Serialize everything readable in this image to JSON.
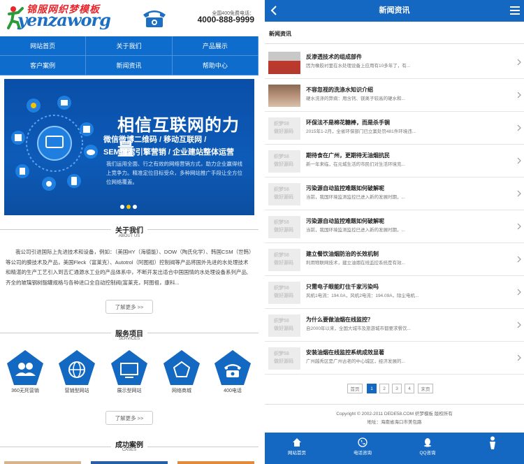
{
  "left": {
    "logo_cn": "锦服网织梦模板",
    "logo_en": "yenzaworg",
    "hotline_label": "全国400免费电话：",
    "hotline": "4000-888-9999",
    "nav": [
      "网站首页",
      "关于我们",
      "产品展示",
      "客户案例",
      "新闻资讯",
      "帮助中心"
    ],
    "banner": {
      "title": "相信互联网的力量",
      "sub1": "微信微博二维码 / 移动互联网 /",
      "sub2": "SEM搜索引擎营销 / 企业建站整体运营",
      "p1": "我们运用全面、行之有效的网络营销方式，助力企业赢得线",
      "p2": "上竞争力。精准定位目标受众，多种网站推广手段让全方位",
      "p3": "位网络覆盖。"
    },
    "about": {
      "title": "关于我们",
      "sub": "ABOUT US",
      "text": "我公司引进国际上先进技术和设备，例如：（美国HY（海德能）、DOW（陶氏化学）、韩国CSM（世韩）等公司的膜技术及产品，美国Fleck（富莱克）、Autotrol（阿图祖）控制阀等产品将国外先进的水处理技术和精湛的生产工艺引入到吉汇通源水工业的产品体系中，不断开发出适合中国国情的水处理设备系列产品,齐全的玻璃钢树脂罐规格与各种进口全自动控制阀(富莱克，阿图祖，康科...",
      "more": "了解更多 >>"
    },
    "services": {
      "title": "服务项目",
      "sub": "SERVICES",
      "items": [
        "360无死营销",
        "营销型网站",
        "展示型网站",
        "网络商城",
        "400电话"
      ],
      "more": "了解更多 >>"
    },
    "cases": {
      "title": "成功案例",
      "sub": "CASES"
    }
  },
  "right": {
    "title": "新闻资讯",
    "crumb": "新闻资讯",
    "placeholder_text": [
      "织梦58",
      "做好源码"
    ],
    "items": [
      {
        "title": "反渗透技术的组成部件",
        "desc": "因为橡胶衬里在水处理设备上应用有10多年了，有..."
      },
      {
        "title": "不容忽视的洗涤水知识介绍",
        "desc": "硬水洗涤的弊病：用含钙、镁离子较高的硬水和..."
      },
      {
        "title": "环保法不是棉花糖棒，而是杀手锏",
        "desc": "2015年1-2月，全省环保部门已立案处罚481件环境违..."
      },
      {
        "title": "期待食在广州，更期待无油烟抗民",
        "desc": "新一年来临，在元城生活的市民们对生活环境充..."
      },
      {
        "title": "污染源自动监控难题如何破解呢",
        "desc": "当前，我国环境监测监控已进入新的发展时期，..."
      },
      {
        "title": "污染源自动监控难题如何破解呢",
        "desc": "当前，我国环境监测监控已进入新的发展时期，..."
      },
      {
        "title": "建立餐饮油烟防治的长效机制",
        "desc": "利用物联网技术，建立油烟在线监控系统是有效..."
      },
      {
        "title": "只需电子眼能盯住千家污染吗",
        "desc": "风机1电流：194.0A，风机2电流：194.09A，除尘电机..."
      },
      {
        "title": "为什么要做油烟在线监控？",
        "desc": "自2000年以来，全国大城市及旅游城市都要求餐饮..."
      },
      {
        "title": "安装油烟在线监控系统成效显著",
        "desc": "广州越秀区是广州古老的中心城区，经济发展的..."
      }
    ],
    "pager": [
      "首页",
      "1",
      "2",
      "3",
      "4",
      "末页"
    ],
    "copyright": "Copyright © 2002-2011 DEDE58.COM 织梦模板 版权所有",
    "address": "地址：海南省海口市美包路",
    "bottom_nav": [
      "网站首页",
      "电话咨询",
      "QQ咨询",
      ""
    ]
  }
}
